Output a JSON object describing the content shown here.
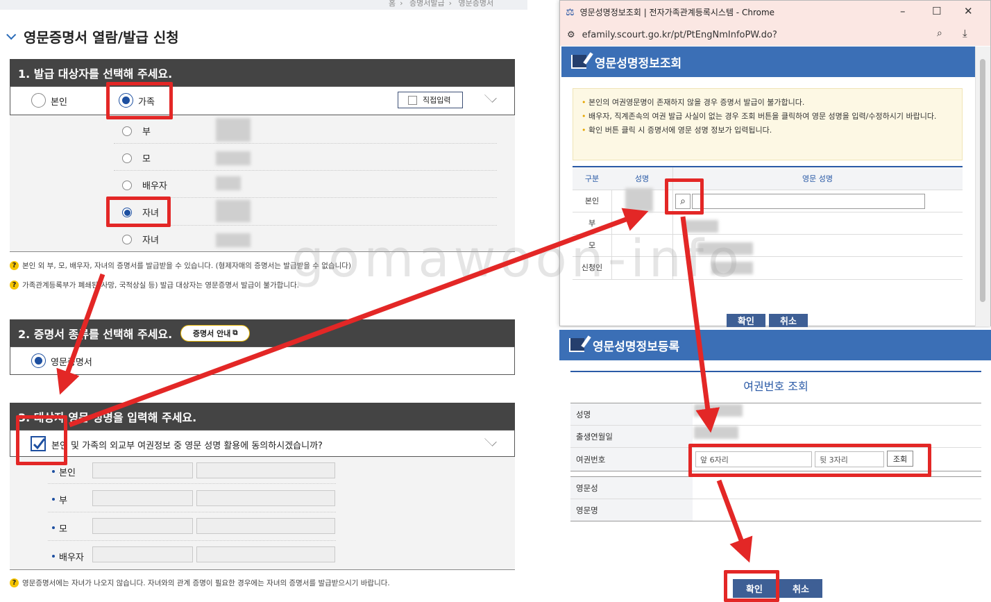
{
  "breadcrumb": [
    "홈",
    "증명서발급",
    "영문증명서"
  ],
  "page_title": "영문증명서 열람/발급 신청",
  "section1": {
    "title": "1. 발급 대상자를 선택해 주세요.",
    "opt_self": "본인",
    "opt_family": "가족",
    "direct_input": "직접입력",
    "family_members": [
      "부",
      "모",
      "배우자",
      "자녀",
      "자녀"
    ],
    "selected_member_index": 3,
    "notes": [
      "본인 외 부, 모, 배우자, 자녀의 증명서를 발급받을 수 있습니다. (형제자매의 증명서는 발급받을 수 없습니다)",
      "가족관계등록부가 폐쇄된(사망, 국적상실 등) 발급 대상자는 영문증명서 발급이 불가합니다."
    ]
  },
  "section2": {
    "title": "2. 증명서 종류를 선택해 주세요.",
    "guide_button": "증명서 안내",
    "option": "영문증명서"
  },
  "section3": {
    "title": "3. 대상자 영문 성명을 입력해 주세요.",
    "consent": "본인 및 가족의 외교부 여권정보 중 영문 성명 활용에 동의하시겠습니까?",
    "consent_checked": true,
    "rows": [
      "본인",
      "부",
      "모",
      "배우자"
    ],
    "note": "영문증명서에는 자녀가 나오지 않습니다. 자녀와의 관계 증명이 필요한 경우에는 자녀의 증명서를 발급받으시기 바랍니다."
  },
  "popup1": {
    "window_title": "영문성명정보조회 | 전자가족관계등록시스템 - Chrome",
    "url": "efamily.scourt.go.kr/pt/PtEngNmInfoPW.do?",
    "header": "영문성명정보조회",
    "notices": [
      "본인의 여권영문명이 존재하지 않을 경우 증명서 발급이 불가합니다.",
      "배우자, 직계존속의 여권 발급 사실이 없는 경우 조회 버튼을 클릭하여 영문 성명을 입력/수정하시기 바랍니다.",
      "확인 버튼 클릭 시 증명서에 영문 성명 정보가 입력됩니다."
    ],
    "columns": [
      "구분",
      "성명",
      "영문 성명"
    ],
    "rows": [
      "본인",
      "부",
      "모",
      "신청인"
    ],
    "ok": "확인",
    "cancel": "취소"
  },
  "popup2": {
    "header": "영문성명정보등록",
    "subtitle": "여권번호 조회",
    "labels": [
      "성명",
      "출생연월일",
      "여권번호"
    ],
    "passport_front_placeholder": "앞 6자리",
    "passport_back_placeholder": "뒷 3자리",
    "lookup": "조회",
    "eng_labels": [
      "영문성",
      "영문명"
    ],
    "ok": "확인",
    "cancel": "취소"
  },
  "watermark": "gomawoon-info",
  "colors": {
    "accent_blue": "#3b6fb6",
    "dark_bar": "#444444",
    "annotation_red": "#e32726",
    "chrome_tab": "#fbe7e3"
  }
}
